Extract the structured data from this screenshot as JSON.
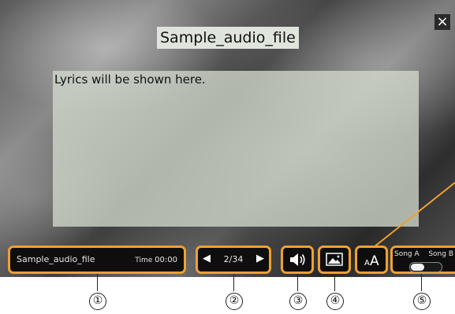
{
  "song_title": "Sample_audio_file",
  "lyrics_placeholder": "Lyrics will be shown here.",
  "close_label": "×",
  "bottom_bar": {
    "song_name": "Sample_audio_file",
    "time_label": "Time",
    "time_value": "00:00",
    "nav": {
      "prev": "◀",
      "page": "2/34",
      "next": "▶"
    },
    "volume_icon": "speaker-icon",
    "image_icon": "picture-icon",
    "font_icon": "font-size-icon",
    "font_glyph": "ᴀA",
    "song_switch": {
      "label_a": "Song A",
      "label_b": "Song B",
      "position": "A"
    }
  },
  "callouts": [
    "①",
    "②",
    "③",
    "④",
    "⑤"
  ],
  "colors": {
    "highlight": "#f0a030",
    "button_bg": "#0e0e0e"
  }
}
